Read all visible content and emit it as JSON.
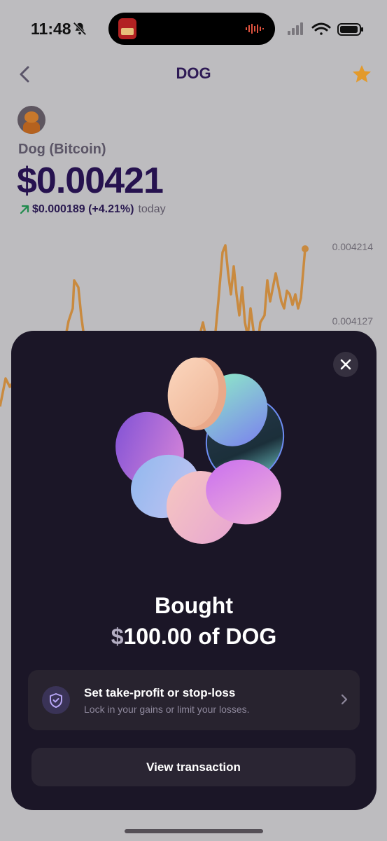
{
  "status_bar": {
    "time": "11:48",
    "icons": [
      "bell-off-icon",
      "audio-waveform-icon",
      "signal-icon",
      "wifi-icon",
      "battery-icon"
    ]
  },
  "header": {
    "title": "DOG",
    "back_icon": "chevron-left-icon",
    "favorite_icon": "star-icon"
  },
  "asset": {
    "name": "Dog (Bitcoin)",
    "price": "$0.00421",
    "change_value": "$0.000189 (+4.21%)",
    "change_period": "today"
  },
  "chart": {
    "tick_labels": [
      "0.004214",
      "0.004127"
    ],
    "line_color": "#c98a3f"
  },
  "modal": {
    "title": "Bought",
    "amount_currency": "$",
    "amount_text": "100.00 of DOG",
    "take_profit": {
      "title": "Set take-profit or stop-loss",
      "subtitle": "Lock in your gains or limit your losses."
    },
    "view_transaction_label": "View transaction"
  },
  "colors": {
    "brand_dark": "#26124f",
    "accent_star": "#e39a2b",
    "modal_bg": "#1b1627",
    "positive": "#1f8a4c"
  }
}
